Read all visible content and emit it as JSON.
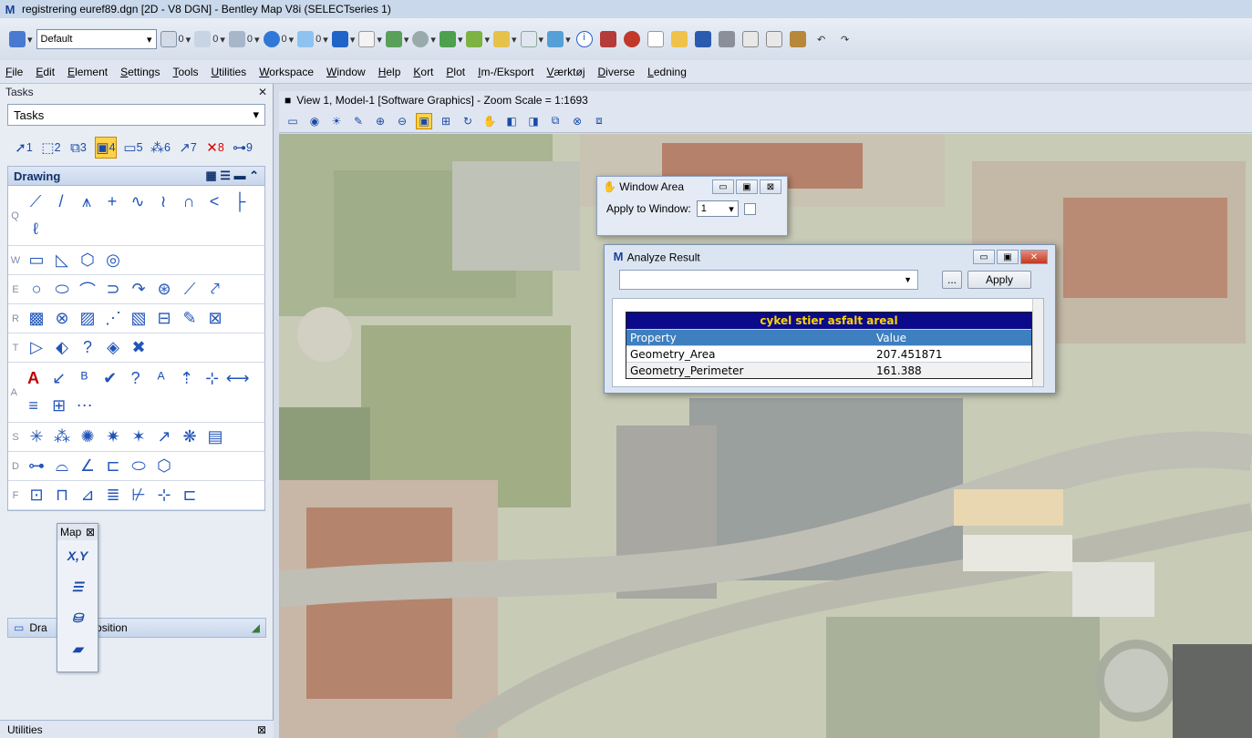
{
  "window": {
    "title": "registrering euref89.dgn [2D - V8 DGN] - Bentley Map V8i (SELECTseries 1)"
  },
  "toolbar": {
    "style_value": "Default",
    "counters": [
      "0",
      "0",
      "0",
      "0",
      "0"
    ]
  },
  "menu": [
    "File",
    "Edit",
    "Element",
    "Settings",
    "Tools",
    "Utilities",
    "Workspace",
    "Window",
    "Help",
    "Kort",
    "Plot",
    "Im-/Eksport",
    "Værktøj",
    "Diverse",
    "Ledning"
  ],
  "tasks": {
    "header": "Tasks",
    "close_glyph": "✕",
    "dropdown_value": "Tasks",
    "tool_numbers": [
      "1",
      "2",
      "3",
      "4",
      "5",
      "6",
      "7",
      "8",
      "9"
    ],
    "drawing_title": "Drawing",
    "row_letters": [
      "Q",
      "W",
      "E",
      "R",
      "T",
      "A",
      "S",
      "D",
      "F"
    ],
    "composition_label_start": "Dra",
    "composition_label_end": "nposition"
  },
  "map_float": {
    "title": "Map",
    "xy": "X,Y"
  },
  "utilities": {
    "label": "Utilities"
  },
  "view": {
    "title": "View 1, Model-1 [Software Graphics] - Zoom Scale = 1:1693"
  },
  "window_area": {
    "title": "Window Area",
    "apply_label": "Apply to Window:",
    "window_value": "1"
  },
  "analyze": {
    "title": "Analyze Result",
    "browse_label": "...",
    "apply_label": "Apply",
    "table_title": "cykel stier asfalt areal",
    "col_property": "Property",
    "col_value": "Value",
    "rows": [
      {
        "property": "Geometry_Area",
        "value": "207.451871"
      },
      {
        "property": "Geometry_Perimeter",
        "value": "161.388"
      }
    ]
  },
  "colors": {
    "title_bar": "#c9d8ea",
    "table_title_bg": "#0a0a8a",
    "table_title_fg": "#ffd400",
    "header_row": "#3e7fbf"
  }
}
